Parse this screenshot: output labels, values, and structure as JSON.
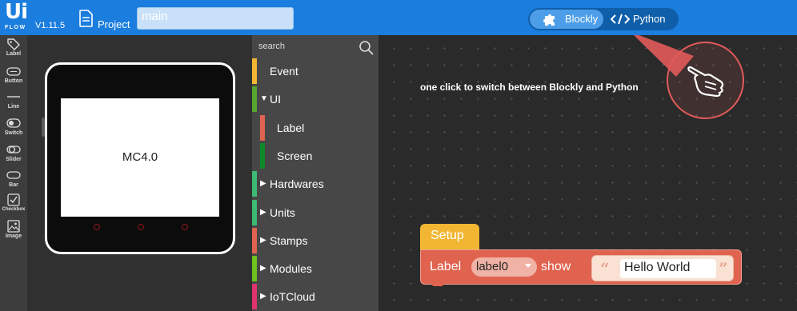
{
  "topbar": {
    "logo_main": "Ui",
    "logo_sub": "FLOW",
    "version": "V1.11.5",
    "project_label": "Project",
    "project_name": "main",
    "mode_blockly": "Blockly",
    "mode_python": "Python"
  },
  "tools": [
    {
      "label": "Label",
      "icon": "tag-icon"
    },
    {
      "label": "Button",
      "icon": "button-icon"
    },
    {
      "label": "Line",
      "icon": "line-icon"
    },
    {
      "label": "Switch",
      "icon": "switch-icon"
    },
    {
      "label": "Slider",
      "icon": "slider-icon"
    },
    {
      "label": "Bar",
      "icon": "bar-icon"
    },
    {
      "label": "Checkbox",
      "icon": "checkbox-icon"
    },
    {
      "label": "Image",
      "icon": "image-icon"
    }
  ],
  "device": {
    "screen_text": "MC4.0"
  },
  "categories": {
    "search_placeholder": "search",
    "items": [
      {
        "label": "Event",
        "color": "#f2b633",
        "expander": ""
      },
      {
        "label": "UI",
        "color": "#55a630",
        "expander": "down"
      },
      {
        "label": "Label",
        "color": "#e0634f",
        "expander": ""
      },
      {
        "label": "Screen",
        "color": "#0f8a2a",
        "expander": ""
      },
      {
        "label": "Hardwares",
        "color": "#3dbb74",
        "expander": "right"
      },
      {
        "label": "Units",
        "color": "#3dbb74",
        "expander": "right"
      },
      {
        "label": "Stamps",
        "color": "#e0634f",
        "expander": "right"
      },
      {
        "label": "Modules",
        "color": "#6dc21e",
        "expander": "right"
      },
      {
        "label": "IoTCloud",
        "color": "#e0336f",
        "expander": "right"
      }
    ]
  },
  "workspace": {
    "hint": "one click to switch between Blockly and Python",
    "setup_label": "Setup",
    "statement": {
      "label": "Label",
      "dropdown_value": "label0",
      "action": "show",
      "string_value": "Hello World"
    }
  },
  "colors": {
    "topbar": "#1b7dde",
    "accent": "#4d9ee8",
    "setup_block": "#f2b633",
    "label_block": "#e0634f",
    "annotation": "#e25a5a"
  }
}
